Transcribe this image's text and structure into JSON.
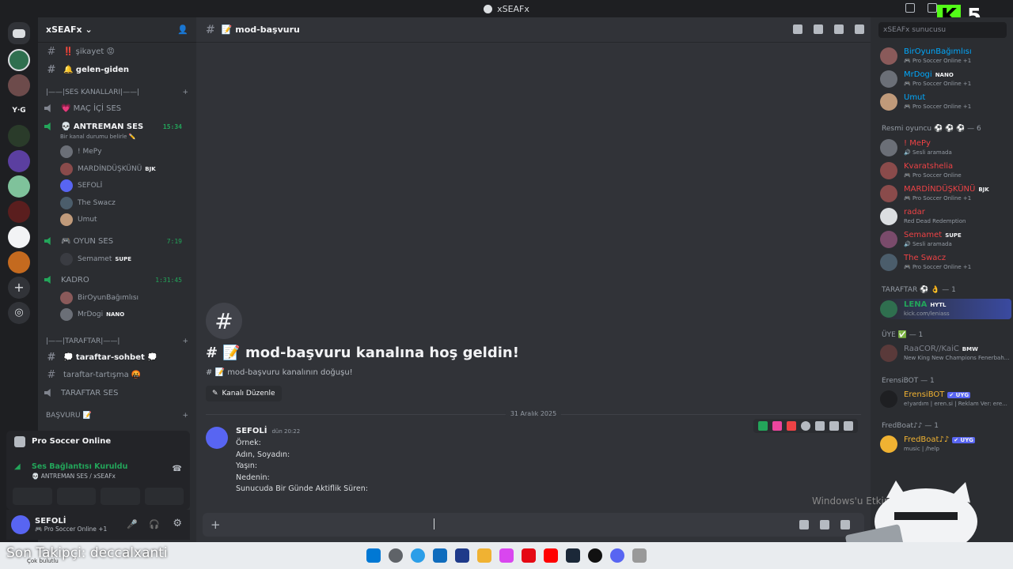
{
  "window": {
    "title": "xSEAFx"
  },
  "server": {
    "name": "xSEAFx"
  },
  "channels": [
    {
      "name": "‼️ şikayet 😡",
      "type": "text"
    },
    {
      "name": "🔔 gelen-giden",
      "type": "text"
    }
  ],
  "voice_category": {
    "label": "|——|SES KANALLARI|——|"
  },
  "voice_channels": {
    "mac_ici": "💗 MAÇ İÇİ SES",
    "antreman": {
      "name": "💀 ANTREMAN SES",
      "time": "15:34",
      "status": "Bir kanal durumu belirle ✏️",
      "users": [
        {
          "name": "! MePy",
          "badge": ""
        },
        {
          "name": "MARDİNDÜŞKÜNÜ",
          "badge": "BJK"
        },
        {
          "name": "SEFOLİ",
          "badge": ""
        },
        {
          "name": "The Swacz",
          "badge": ""
        },
        {
          "name": "Umut",
          "badge": ""
        }
      ]
    },
    "oyun": {
      "name": "🎮 OYUN SES",
      "time": "7:19",
      "users": [
        {
          "name": "Semamet",
          "badge": "SUPE"
        }
      ]
    },
    "kadro": {
      "name": "KADRO",
      "time": "1:31:45",
      "users": [
        {
          "name": "BirOyunBağımlısı",
          "badge": ""
        },
        {
          "name": "MrDogi",
          "badge": "NANO"
        }
      ]
    }
  },
  "fan_category": {
    "label": "|——|TARAFTAR|——|"
  },
  "fan_channels": {
    "sohbet": "💭 taraftar-sohbet 💭",
    "tartisma": "taraftar-tartışma 🤬",
    "ses": "TARAFTAR SES"
  },
  "application_category": {
    "label": "BAŞVURU 📝"
  },
  "activity": {
    "label": "Pro Soccer Online"
  },
  "voice_status": {
    "title": "Ses Bağlantısı Kuruldu",
    "subtitle": "💀 ANTREMAN SES / xSEAFx"
  },
  "user": {
    "name": "SEFOLİ",
    "status": "🎮 Pro Soccer Online +1"
  },
  "channel_header": {
    "name": "📝 mod-başvuru"
  },
  "welcome": {
    "icon": "#",
    "title": "# 📝 mod-başvuru kanalına hoş geldin!",
    "subtitle": "# 📝 mod-başvuru kanalının doğuşu!",
    "edit_button": "Kanalı Düzenle"
  },
  "date_divider": "31 Aralık 2025",
  "message": {
    "author": "SEFOLİ",
    "time": "dün 20:22",
    "lines": [
      "Örnek:",
      "Adın, Soyadın:",
      "Yaşın:",
      "Nedenin:",
      "Sunucuda Bir Günde Aktiflik Süren:"
    ]
  },
  "members": {
    "search_placeholder": "xSEAFx sunucusu",
    "top": [
      {
        "name": "BirOyunBağımlısı",
        "status": "🎮 Pro Soccer Online +1",
        "color": "#00a8fc"
      },
      {
        "name": "MrDogi",
        "badge": "NANO",
        "status": "🎮 Pro Soccer Online +1",
        "color": "#00a8fc"
      },
      {
        "name": "Umut",
        "status": "🎮 Pro Soccer Online +1",
        "color": "#00a8fc"
      }
    ],
    "groups": [
      {
        "label": "Resmi oyuncu ⚽ ⚽ ⚽ — 6",
        "members": [
          {
            "name": "! MePy",
            "status": "🔊 Sesli aramada",
            "color": "#ed4245"
          },
          {
            "name": "Kvaratshelia",
            "status": "🎮 Pro Soccer Online",
            "color": "#ed4245"
          },
          {
            "name": "MARDİNDÜŞKÜNÜ",
            "badge": "BJK",
            "status": "🎮 Pro Soccer Online +1",
            "color": "#ed4245"
          },
          {
            "name": "radar",
            "status": "Red Dead Redemption",
            "color": "#ed4245"
          },
          {
            "name": "Semamet",
            "badge": "SUPE",
            "status": "🔊 Sesli aramada",
            "color": "#ed4245"
          },
          {
            "name": "The Swacz",
            "status": "🎮 Pro Soccer Online +1",
            "color": "#ed4245"
          }
        ]
      },
      {
        "label": "TARAFTAR ⚽ 👌 — 1",
        "members": [
          {
            "name": "LENA",
            "badge": "HYTL",
            "status": "kick.com/leniass",
            "color": "#23a55a"
          }
        ]
      },
      {
        "label": "ÜYE ✅ — 1",
        "members": [
          {
            "name": "RaaCOR//KaiC",
            "badge": "BMW",
            "status": "New King New Champions Fenerbah...",
            "color": "#80848e"
          }
        ]
      },
      {
        "label": "ErensiBOT — 1",
        "members": [
          {
            "name": "ErensiBOT",
            "badge": "✔ UYG",
            "status": "e!yardım | eren.si | Reklam Ver: ere...",
            "color": "#f0b232"
          }
        ]
      },
      {
        "label": "FredBoat♪♪ — 1",
        "members": [
          {
            "name": "FredBoat♪♪",
            "badge": "✔ UYG",
            "status": "music | /help",
            "color": "#f0b232"
          }
        ]
      }
    ]
  },
  "overlay": {
    "follower": "Son Takipçi: deccalxanti",
    "sub": "Çok bulutlu",
    "kick_count": "5",
    "windows_watermark": "Windows'u Etkinl..."
  },
  "colors": {
    "accent": "#5865f2",
    "online": "#23a55a",
    "kick": "#53fc18"
  }
}
